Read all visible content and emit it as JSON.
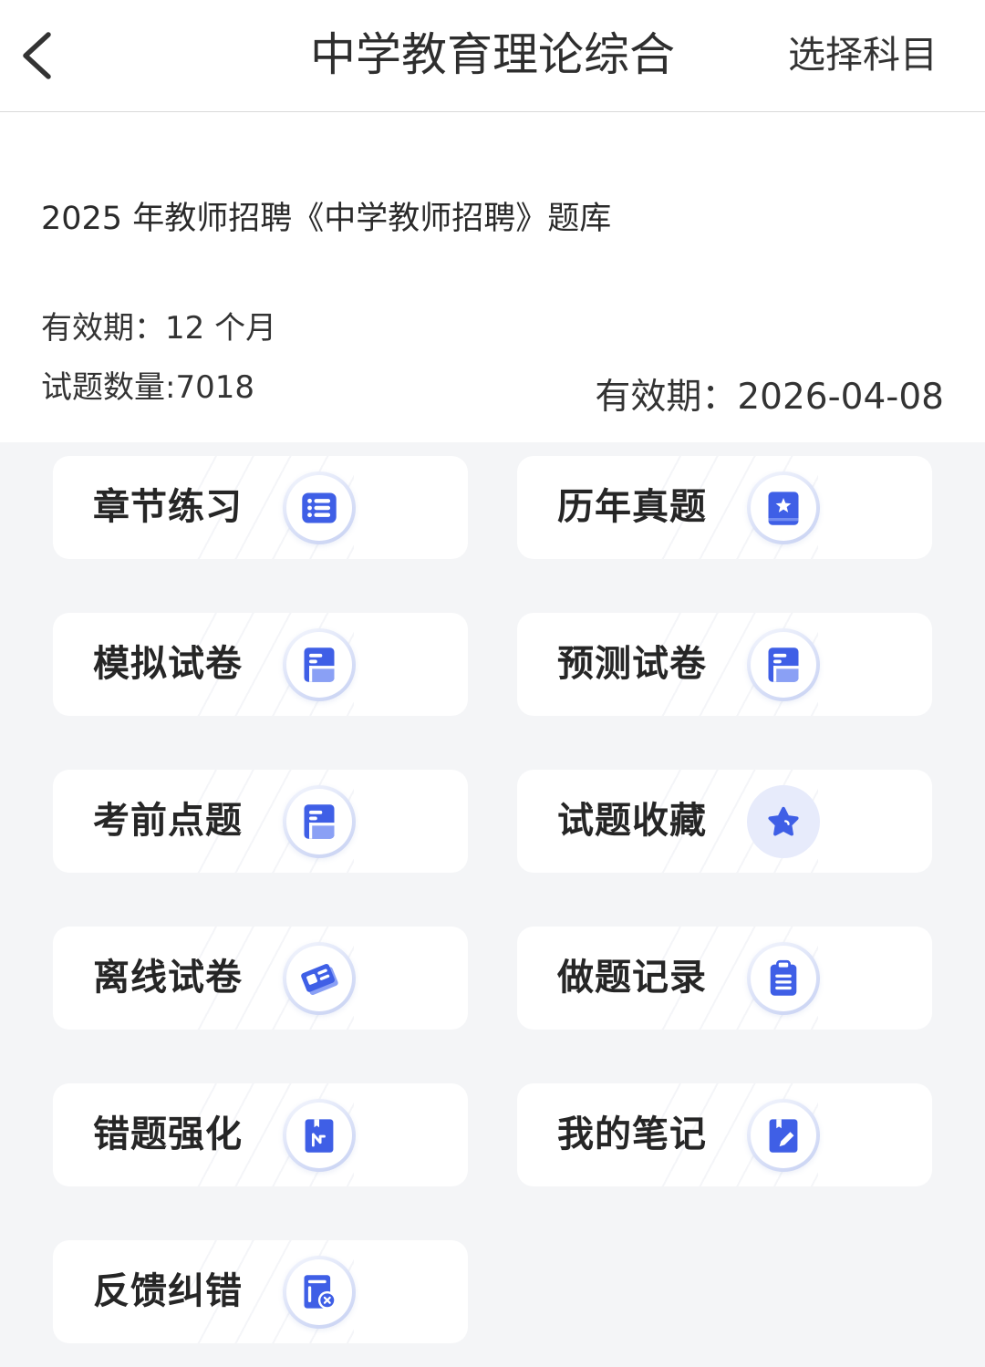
{
  "header": {
    "back_icon": "chevron-left-icon",
    "title": "中学教育理论综合",
    "select_subject": "选择科目"
  },
  "bank": {
    "name": "2025 年教师招聘《中学教师招聘》题库",
    "validity": "有效期：12 个月",
    "question_count": "试题数量:7018",
    "expiry": "有效期：2026-04-08"
  },
  "menu": [
    {
      "label": "章节练习",
      "icon": "list-icon"
    },
    {
      "label": "历年真题",
      "icon": "star-badge-icon"
    },
    {
      "label": "模拟试卷",
      "icon": "document-icon"
    },
    {
      "label": "预测试卷",
      "icon": "document-icon"
    },
    {
      "label": "考前点题",
      "icon": "document-icon"
    },
    {
      "label": "试题收藏",
      "icon": "star-icon"
    },
    {
      "label": "离线试卷",
      "icon": "offline-paper-icon"
    },
    {
      "label": "做题记录",
      "icon": "clipboard-icon"
    },
    {
      "label": "错题强化",
      "icon": "bookmark-icon"
    },
    {
      "label": "我的笔记",
      "icon": "note-edit-icon"
    },
    {
      "label": "反馈纠错",
      "icon": "document-error-icon"
    }
  ],
  "colors": {
    "accent": "#3f5fe6",
    "accent_light": "#8aa0f5",
    "background": "#f4f5f7",
    "card": "#ffffff",
    "text": "#333333",
    "label": "#262626"
  }
}
